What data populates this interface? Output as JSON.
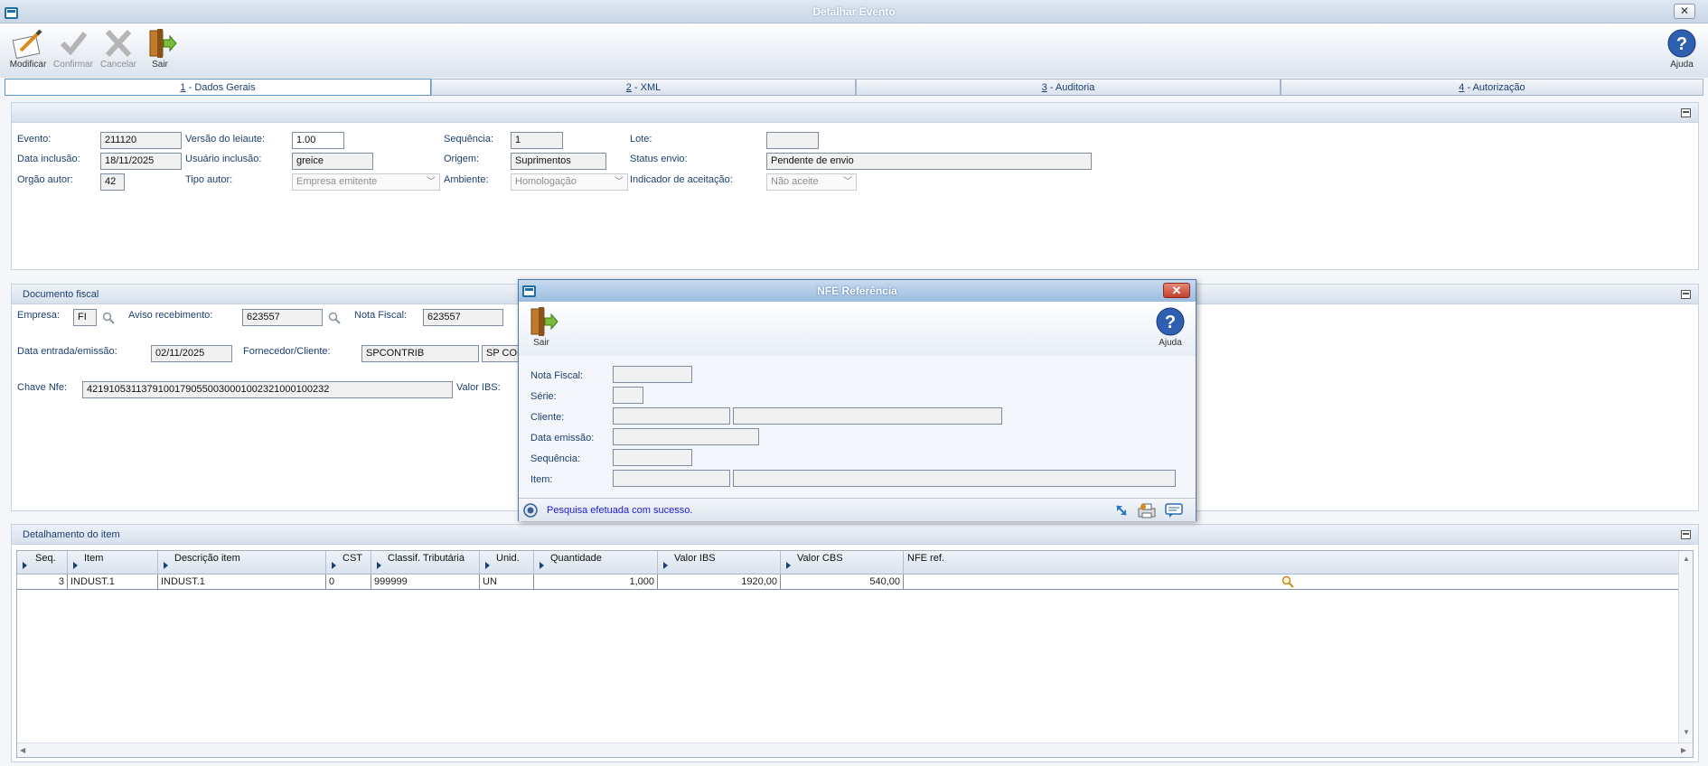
{
  "window": {
    "title": "Detalhar Evento"
  },
  "toolbar": {
    "modificar": "Modificar",
    "confirmar": "Confirmar",
    "cancelar": "Cancelar",
    "sair": "Sair",
    "ajuda": "Ajuda"
  },
  "tabs": [
    {
      "num": "1",
      "label": " - Dados Gerais"
    },
    {
      "num": "2",
      "label": " - XML"
    },
    {
      "num": "3",
      "label": " - Auditoria"
    },
    {
      "num": "4",
      "label": " - Autorização"
    }
  ],
  "general": {
    "evento_label": "Evento:",
    "evento": "211120",
    "versao_label": "Versão do leiaute:",
    "versao": "1.00",
    "sequencia_label": "Sequência:",
    "sequencia": "1",
    "lote_label": "Lote:",
    "lote": "",
    "data_inclusao_label": "Data inclusão:",
    "data_inclusao": "18/11/2025",
    "usuario_label": "Usuário inclusão:",
    "usuario": "greice",
    "origem_label": "Origem:",
    "origem": "Suprimentos",
    "status_label": "Status envio:",
    "status": "Pendente de envio",
    "orgao_label": "Orgão autor:",
    "orgao": "42",
    "tipo_autor_label": "Tipo autor:",
    "tipo_autor": "Empresa emitente",
    "ambiente_label": "Ambiente:",
    "ambiente": "Homologação",
    "indicador_label": "Indicador de aceitação:",
    "indicador": "Não aceite"
  },
  "documento": {
    "title": "Documento fiscal",
    "empresa_label": "Empresa:",
    "empresa": "FI",
    "aviso_label": "Aviso recebimento:",
    "aviso": "623557",
    "nota_label": "Nota Fiscal:",
    "nota": "623557",
    "data_label": "Data entrada/emissão:",
    "data": "02/11/2025",
    "fornecedor_label": "Fornecedor/Cliente:",
    "fornecedor_code": "SPCONTRIB",
    "fornecedor_name": "SP CON",
    "chave_label": "Chave Nfe:",
    "chave": "42191053113791001790550030001002321000100232",
    "valor_ibs_label": "Valor IBS:"
  },
  "detalhamento": {
    "title": "Detalhamento do item",
    "columns": [
      "Seq.",
      "Item",
      "Descrição item",
      "CST",
      "Classif. Tributária",
      "Unid.",
      "Quantidade",
      "Valor IBS",
      "Valor CBS",
      "NFE ref."
    ],
    "rows": [
      {
        "seq": "3",
        "item": "INDUST.1",
        "descricao": "INDUST.1",
        "cst": "0",
        "classif": "999999",
        "unid": "UN",
        "quantidade": "1,000",
        "valor_ibs": "1920,00",
        "valor_cbs": "540,00",
        "nfe_ref": ""
      }
    ]
  },
  "modal": {
    "title": "NFE Referência",
    "sair": "Sair",
    "ajuda": "Ajuda",
    "nota_label": "Nota Fiscal:",
    "serie_label": "Série:",
    "cliente_label": "Cliente:",
    "data_label": "Data emissão:",
    "sequencia_label": "Sequência:",
    "item_label": "Item:",
    "status_message": "Pesquisa efetuada com sucesso."
  },
  "colors": {
    "label_blue": "#1c3f6e",
    "status_text": "#1a1ad6",
    "accent": "#5a95d0"
  }
}
